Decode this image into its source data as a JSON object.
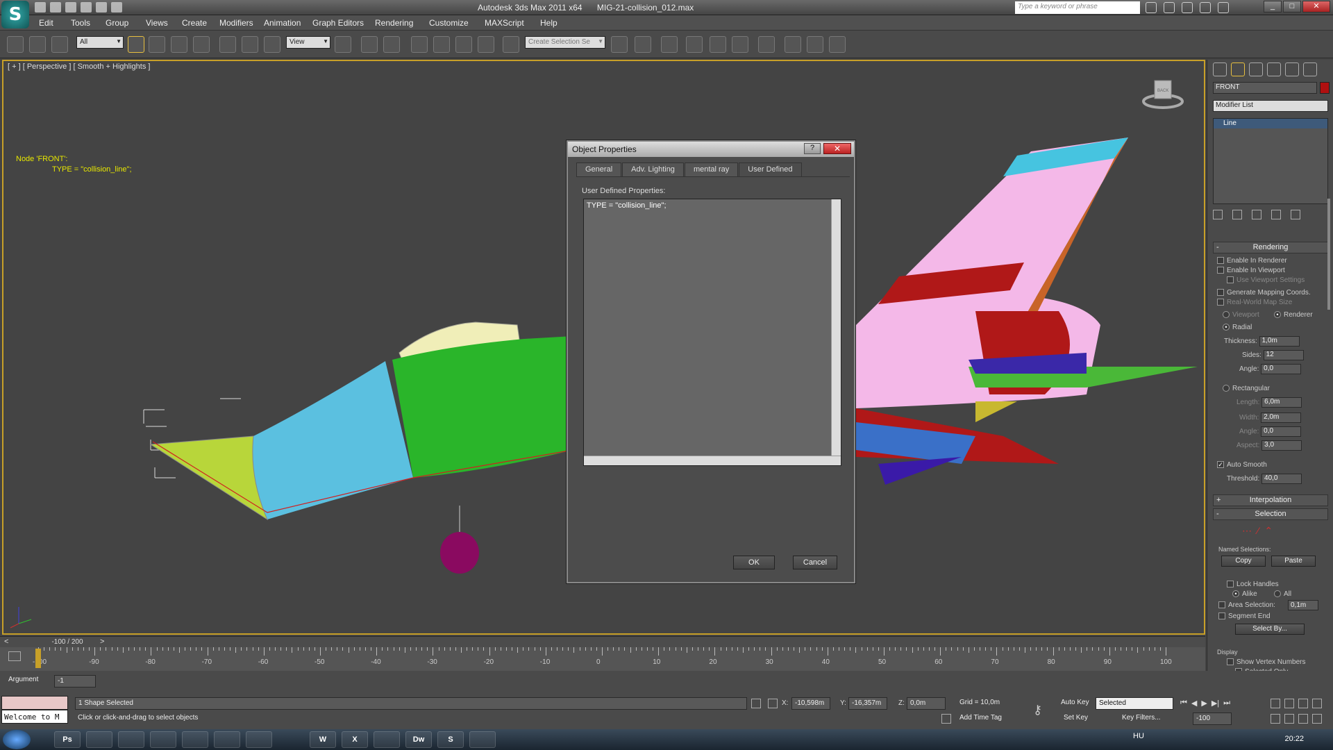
{
  "window": {
    "app_title": "Autodesk 3ds Max  2011 x64",
    "file_name": "MIG-21-collision_012.max",
    "search_placeholder": "Type a keyword or phrase",
    "logo_letter": "S"
  },
  "menu": [
    "Edit",
    "Tools",
    "Group",
    "Views",
    "Create",
    "Modifiers",
    "Animation",
    "Graph Editors",
    "Rendering",
    "Customize",
    "MAXScript",
    "Help"
  ],
  "toolbar": {
    "filter_select": "All",
    "ref_coord": "View",
    "selection_set_placeholder": "Create Selection Se"
  },
  "viewport": {
    "label": "[ + ] [ Perspective ] [ Smooth + Highlights ]",
    "node_line1": "Node 'FRONT':",
    "node_line2": "TYPE = \"collision_line\";",
    "viewcube_label": "BACK"
  },
  "dialog": {
    "title": "Object Properties",
    "help": "?",
    "close": "✕",
    "tabs": [
      "General",
      "Adv. Lighting",
      "mental ray",
      "User Defined"
    ],
    "active_tab": "User Defined",
    "field_label": "User Defined Properties:",
    "field_value": "TYPE = \"collision_line\";",
    "ok": "OK",
    "cancel": "Cancel"
  },
  "command_panel": {
    "object_name": "FRONT",
    "object_color": "#b01010",
    "modifier_list": "Modifier List",
    "stack_item": "Line",
    "rendering_header": "Rendering",
    "enable_renderer": "Enable In Renderer",
    "enable_viewport": "Enable In Viewport",
    "use_viewport_settings": "Use Viewport Settings",
    "gen_mapping": "Generate Mapping Coords.",
    "real_world": "Real-World Map Size",
    "viewport_radio": "Viewport",
    "renderer_radio": "Renderer",
    "radial": "Radial",
    "thickness_label": "Thickness:",
    "thickness": "1,0m",
    "sides_label": "Sides:",
    "sides": "12",
    "angle_label": "Angle:",
    "angle": "0,0",
    "rectangular": "Rectangular",
    "length_label": "Length:",
    "length": "6,0m",
    "width_label": "Width:",
    "width": "2,0m",
    "angle2_label": "Angle:",
    "angle2": "0,0",
    "aspect_label": "Aspect:",
    "aspect": "3,0",
    "auto_smooth": "Auto Smooth",
    "threshold_label": "Threshold:",
    "threshold": "40,0",
    "interpolation_header": "Interpolation",
    "selection_header": "Selection",
    "named_selections": "Named Selections:",
    "copy": "Copy",
    "paste": "Paste",
    "lock_handles": "Lock Handles",
    "alike": "Alike",
    "all": "All",
    "area_selection": "Area Selection:",
    "area_value": "0,1m",
    "segment_end": "Segment End",
    "select_by": "Select By...",
    "display_header": "Display",
    "show_vertex_numbers": "Show Vertex Numbers",
    "selected_only": "Selected Only"
  },
  "timeline": {
    "frame": "-100 / 200",
    "ticks": [
      "-100",
      "-90",
      "-80",
      "-70",
      "-60",
      "-50",
      "-40",
      "-30",
      "-20",
      "-10",
      "0",
      "10",
      "20",
      "30",
      "40",
      "50",
      "60",
      "70",
      "80",
      "90",
      "100"
    ]
  },
  "status": {
    "argument_label": "Argument",
    "argument_value": "-1",
    "listener": "Welcome to M",
    "selected_count": "1 Shape Selected",
    "prompt": "Click or click-and-drag to select objects",
    "x_label": "X:",
    "x": "-10,598m",
    "y_label": "Y:",
    "y": "-16,357m",
    "z_label": "Z:",
    "z": "0,0m",
    "grid": "Grid = 10,0m",
    "add_time_tag": "Add Time Tag",
    "auto_key": "Auto Key",
    "set_key": "Set Key",
    "key_mode": "Selected",
    "key_filters": "Key Filters...",
    "current_frame": "-100"
  },
  "taskbar": {
    "apps": [
      "Ps",
      "",
      "",
      "",
      "",
      "",
      "",
      "W",
      "X",
      "",
      "Dw",
      "S",
      ""
    ],
    "lang": "HU",
    "clock": "20:22"
  }
}
